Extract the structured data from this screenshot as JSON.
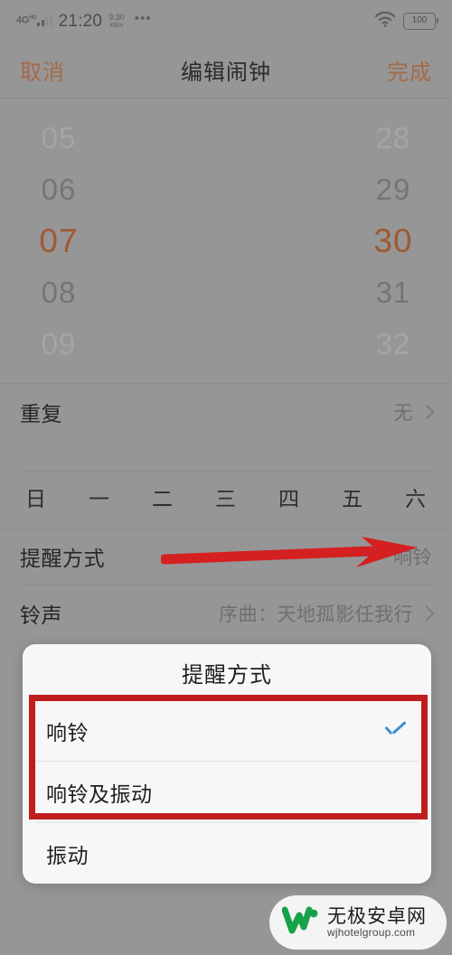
{
  "status_bar": {
    "network_type": "4G",
    "network_sup": "HD",
    "time": "21:20",
    "speed_value": "9.30",
    "speed_unit": "KB/s",
    "more_icon": "•••",
    "wifi_icon": "wifi-icon",
    "battery_level": "100"
  },
  "nav": {
    "cancel": "取消",
    "title": "编辑闹钟",
    "done": "完成"
  },
  "time_picker": {
    "hours": [
      "05",
      "06",
      "07",
      "08",
      "09"
    ],
    "minutes": [
      "28",
      "29",
      "30",
      "31",
      "32"
    ],
    "selected_hour": "07",
    "selected_minute": "30",
    "selected_color": "#9e5a30"
  },
  "rows": {
    "repeat": {
      "label": "重复",
      "value": "无"
    },
    "weekdays": [
      "日",
      "一",
      "二",
      "三",
      "四",
      "五",
      "六"
    ],
    "reminder_mode": {
      "label": "提醒方式",
      "value": "响铃"
    },
    "ringtone": {
      "label": "铃声",
      "value": "序曲：天地孤影任我行"
    }
  },
  "annotation": {
    "arrow_color": "#d42020",
    "box_color": "#bf1d1d"
  },
  "dialog": {
    "title": "提醒方式",
    "options": [
      {
        "label": "响铃",
        "checked": true
      },
      {
        "label": "响铃及振动",
        "checked": false
      },
      {
        "label": "振动",
        "checked": false
      }
    ],
    "check_color": "#3d8fd0"
  },
  "watermark": {
    "logo": "w-logo-icon",
    "name_cn": "无极安卓网",
    "url": "wjhotelgroup.com"
  }
}
